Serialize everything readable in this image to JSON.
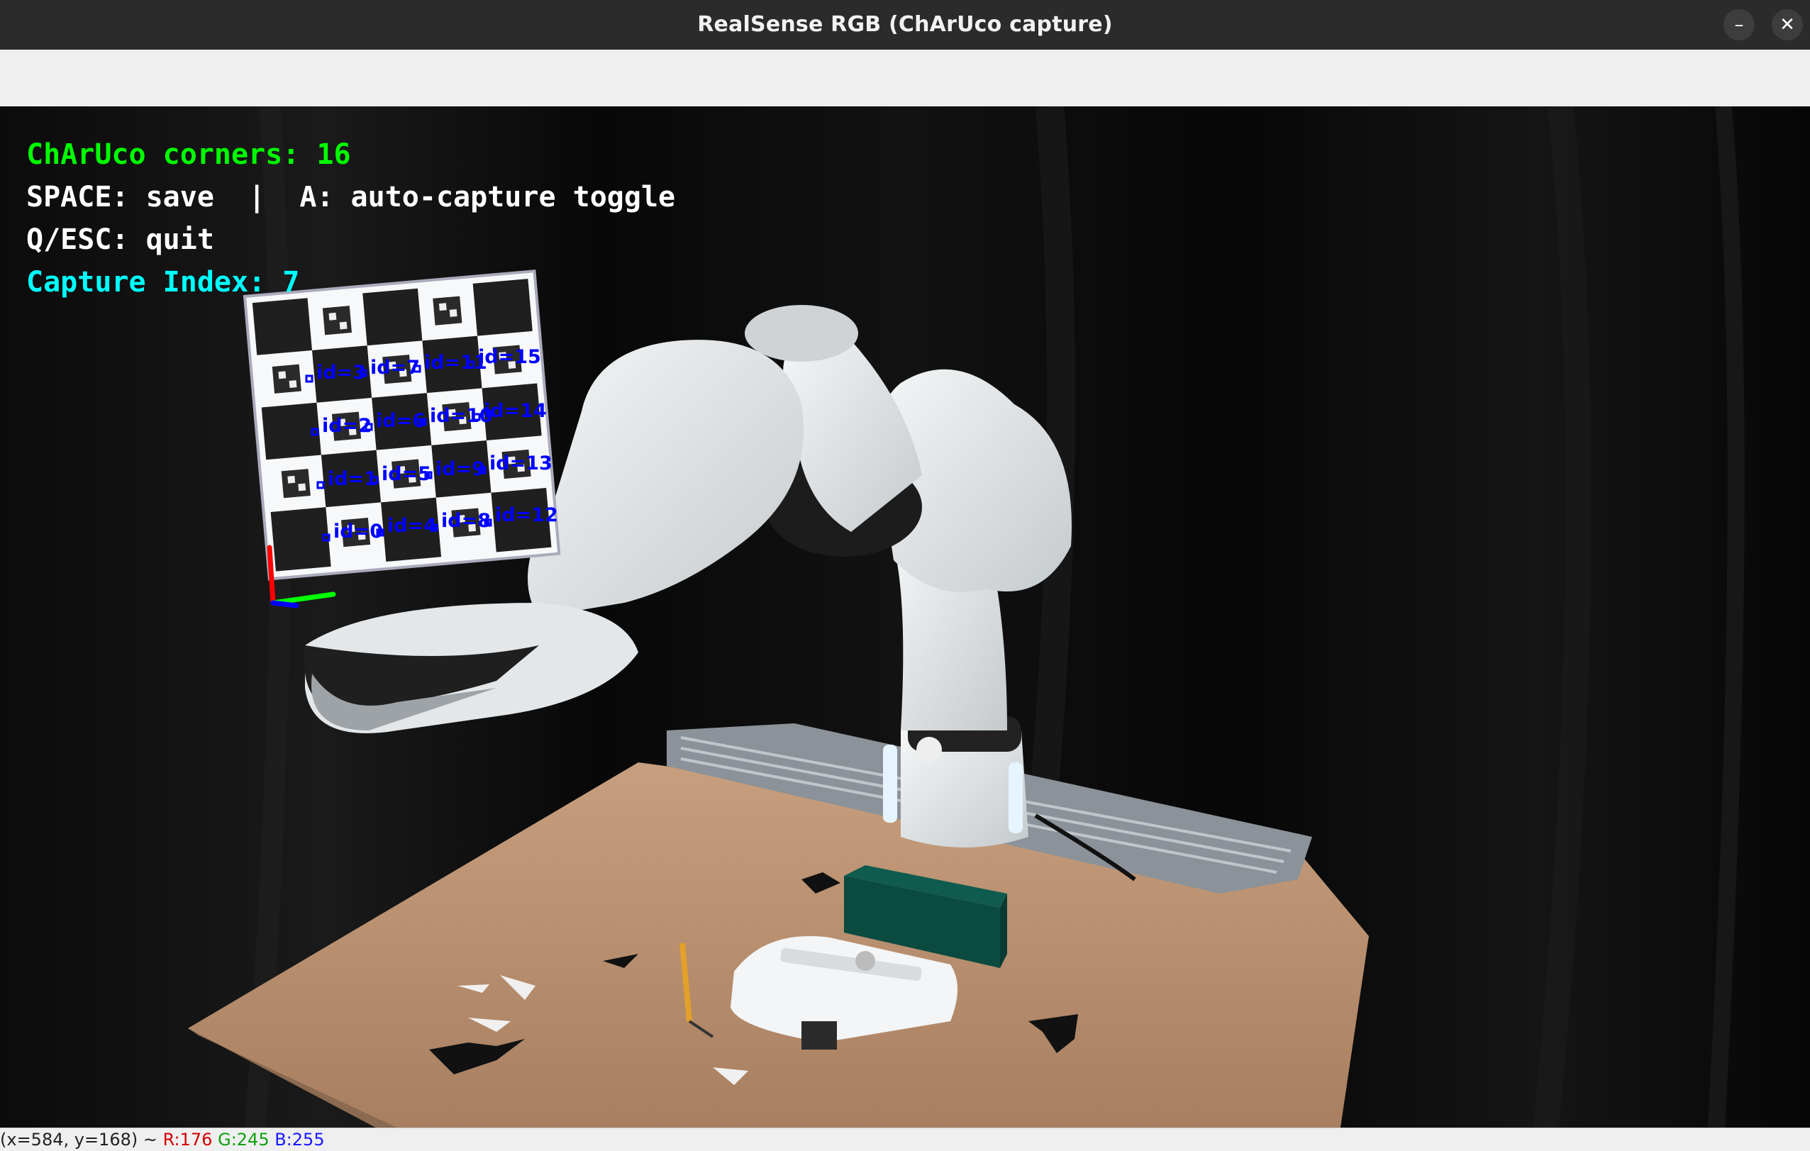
{
  "window": {
    "title": "RealSense RGB (ChArUco capture)",
    "minimize_glyph": "–",
    "close_glyph": "✕"
  },
  "overlay": {
    "corners_text": "ChArUco corners: 16",
    "keys_save_text": "SPACE: save  |  A: auto-capture toggle",
    "keys_quit_text": "Q/ESC: quit",
    "capture_index_text": "Capture Index: 7",
    "corners_color": "#00ff00",
    "keys_color": "#ffffff",
    "capture_color": "#00ffff",
    "corner_id_color": "#0000ff",
    "corner_labels": [
      "id=0",
      "id=1",
      "id=2",
      "id=3",
      "id=4",
      "id=5",
      "id=6",
      "id=7",
      "id=8",
      "id=9",
      "id=10",
      "id=11",
      "id=12",
      "id=13",
      "id=14",
      "id=15"
    ]
  },
  "status": {
    "coords": "(x=584, y=168) ~",
    "r": "R:176",
    "g": "G:245",
    "b": "B:255"
  }
}
